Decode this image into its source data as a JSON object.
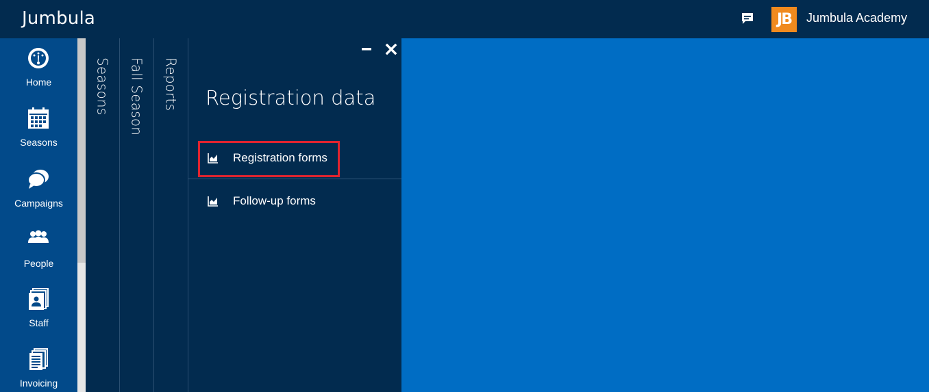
{
  "header": {
    "brand": "Jumbula",
    "logo_text": "JB",
    "org_name": "Jumbula Academy",
    "chat_icon": "chat-icon"
  },
  "nav": {
    "items": [
      {
        "label": "Home",
        "icon": "home-icon"
      },
      {
        "label": "Seasons",
        "icon": "calendar-icon"
      },
      {
        "label": "Campaigns",
        "icon": "chat-bubbles-icon"
      },
      {
        "label": "People",
        "icon": "people-icon"
      },
      {
        "label": "Staff",
        "icon": "staff-icon"
      },
      {
        "label": "Invoicing",
        "icon": "invoice-icon"
      }
    ]
  },
  "breadcrumbs": {
    "seasons": "Seasons",
    "fall_season": "Fall Season",
    "reports": "Reports"
  },
  "panel": {
    "title": "Registration data",
    "items": [
      {
        "label": "Registration forms",
        "icon": "chart-icon"
      },
      {
        "label": "Follow-up forms",
        "icon": "chart-icon"
      }
    ]
  },
  "colors": {
    "header_bg": "#022b4f",
    "nav_bg": "#024a8a",
    "content_bg": "#006dc4",
    "logo_bg": "#f08a1e",
    "highlight": "#e0242f"
  }
}
